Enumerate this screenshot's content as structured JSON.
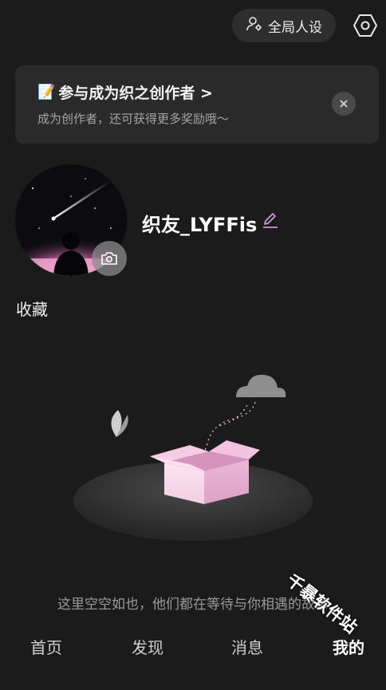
{
  "header": {
    "persona_label": "全局人设",
    "settings_icon": "gear-hexagon-icon",
    "persona_icon": "person-gear-icon"
  },
  "banner": {
    "emoji": "📝",
    "title": "参与成为织之创作者 >",
    "subtitle": "成为创作者，还可获得更多奖励哦～",
    "close_icon": "close-icon"
  },
  "profile": {
    "username": "织友_LYFFis",
    "camera_icon": "camera-icon",
    "edit_icon": "edit-pencil-icon"
  },
  "collection": {
    "title": "收藏",
    "empty_text": "这里空空如也，他们都在等待与你相遇的故事"
  },
  "nav": {
    "items": [
      {
        "label": "首页",
        "active": false
      },
      {
        "label": "发现",
        "active": false
      },
      {
        "label": "消息",
        "active": false
      },
      {
        "label": "我的",
        "active": true
      }
    ]
  },
  "watermark": {
    "text": "千暴软件站"
  },
  "colors": {
    "background": "#1b1b1b",
    "card": "#2a2a2a",
    "accent_pink": "#e8a6d0",
    "edit_purple": "#c89ad8"
  }
}
